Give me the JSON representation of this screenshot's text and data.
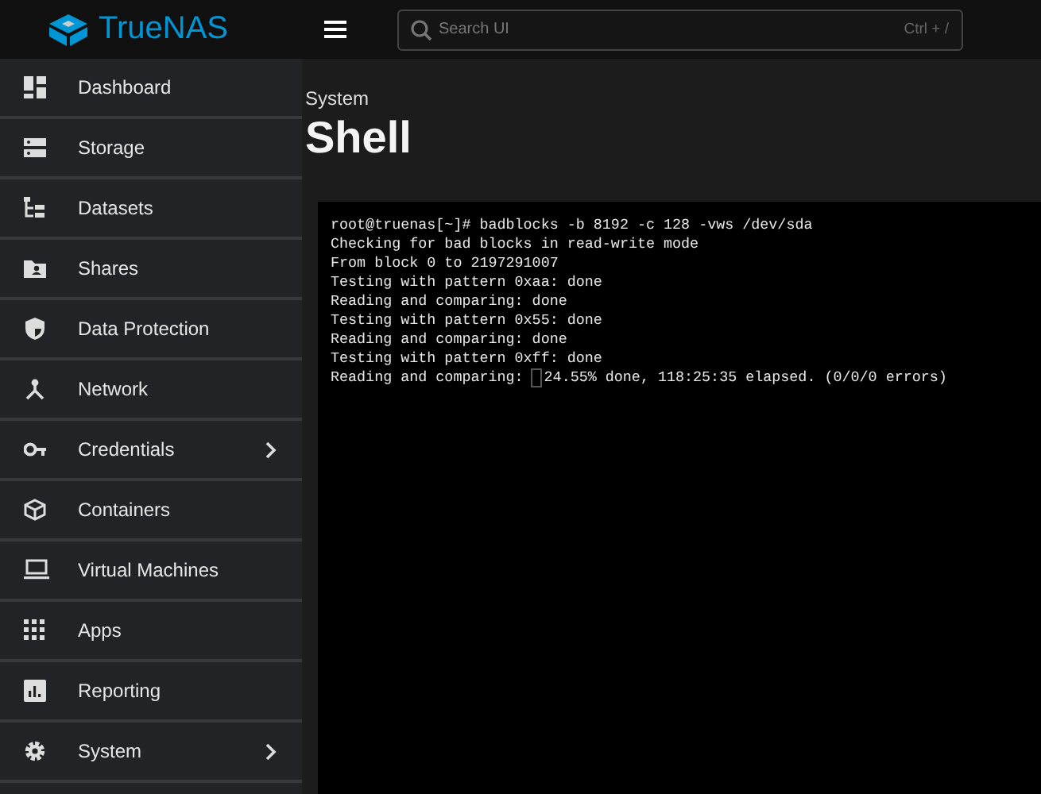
{
  "topbar": {
    "logo": "TrueNAS",
    "search": {
      "placeholder": "Search UI",
      "shortcut": "Ctrl + /"
    }
  },
  "sidebar": {
    "items": [
      {
        "label": "Dashboard",
        "submenu": false
      },
      {
        "label": "Storage",
        "submenu": false
      },
      {
        "label": "Datasets",
        "submenu": false
      },
      {
        "label": "Shares",
        "submenu": false
      },
      {
        "label": "Data Protection",
        "submenu": false
      },
      {
        "label": "Network",
        "submenu": false
      },
      {
        "label": "Credentials",
        "submenu": true
      },
      {
        "label": "Containers",
        "submenu": false
      },
      {
        "label": "Virtual Machines",
        "submenu": false
      },
      {
        "label": "Apps",
        "submenu": false
      },
      {
        "label": "Reporting",
        "submenu": false
      },
      {
        "label": "System",
        "submenu": true
      }
    ]
  },
  "page": {
    "breadcrumb": "System",
    "title": "Shell"
  },
  "terminal": {
    "lines": [
      "root@truenas[~]# badblocks -b 8192 -c 128 -vws /dev/sda",
      "Checking for bad blocks in read-write mode",
      "From block 0 to 2197291007",
      "Testing with pattern 0xaa: done",
      "Reading and comparing: done",
      "Testing with pattern 0x55: done",
      "Reading and comparing: done",
      "Testing with pattern 0xff: done"
    ],
    "last_line": {
      "before_cursor": "Reading and comparing:",
      "after_cursor": "24.55% done, 118:25:35 elapsed. (0/0/0 errors)"
    }
  }
}
